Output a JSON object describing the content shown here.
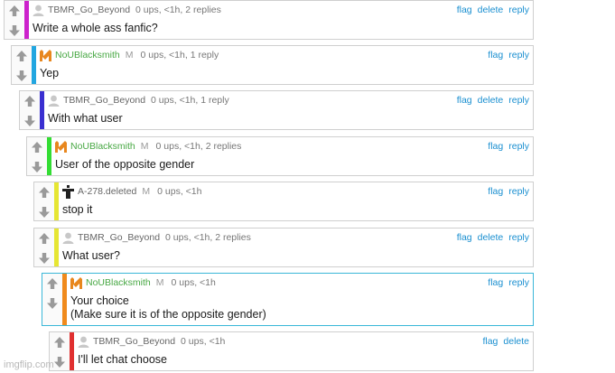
{
  "colors": {
    "link": "#1a8fd0",
    "highlight_border": "#3ab7d8"
  },
  "watermark": "imgflip.com",
  "comments": [
    {
      "user": "TBMR_Go_Beyond",
      "meta": "0 ups, <1h, 2 replies",
      "body": [
        "Write a whole ass fanfic?"
      ],
      "actions": [
        "flag",
        "delete",
        "reply"
      ],
      "bar_color": "#cc22cc",
      "avatar": "default-avatar-icon"
    },
    {
      "user": "NoUBlacksmith",
      "mod": "M",
      "meta": "0 ups, <1h, 1 reply",
      "body": [
        "Yep"
      ],
      "actions": [
        "flag",
        "reply"
      ],
      "bar_color": "#22a6e0",
      "avatar": "nou-avatar-icon"
    },
    {
      "user": "TBMR_Go_Beyond",
      "meta": "0 ups, <1h, 1 reply",
      "body": [
        "With what user"
      ],
      "actions": [
        "flag",
        "delete",
        "reply"
      ],
      "bar_color": "#3a2fd0",
      "avatar": "default-avatar-icon"
    },
    {
      "user": "NoUBlacksmith",
      "mod": "M",
      "meta": "0 ups, <1h, 2 replies",
      "body": [
        "User of the opposite gender"
      ],
      "actions": [
        "flag",
        "reply"
      ],
      "bar_color": "#33dd33",
      "avatar": "nou-avatar-icon"
    },
    {
      "user": "A-278.deleted",
      "mod": "M",
      "meta": "0 ups, <1h",
      "body": [
        "stop it"
      ],
      "actions": [
        "flag",
        "reply"
      ],
      "bar_color": "#e6e633",
      "avatar": "dark-figure-avatar-icon"
    },
    {
      "user": "TBMR_Go_Beyond",
      "meta": "0 ups, <1h, 2 replies",
      "body": [
        "What user?"
      ],
      "actions": [
        "flag",
        "delete",
        "reply"
      ],
      "bar_color": "#e6e633",
      "avatar": "default-avatar-icon"
    },
    {
      "user": "NoUBlacksmith",
      "mod": "M",
      "meta": "0 ups, <1h",
      "body": [
        "Your choice",
        "(Make sure it is of the opposite gender)"
      ],
      "actions": [
        "flag",
        "reply"
      ],
      "bar_color": "#f08a1c",
      "avatar": "nou-avatar-icon",
      "highlighted": true
    },
    {
      "user": "TBMR_Go_Beyond",
      "meta": "0 ups, <1h",
      "body": [
        "I'll let chat choose"
      ],
      "actions": [
        "flag",
        "delete"
      ],
      "bar_color": "#e03030",
      "avatar": "default-avatar-icon"
    }
  ]
}
